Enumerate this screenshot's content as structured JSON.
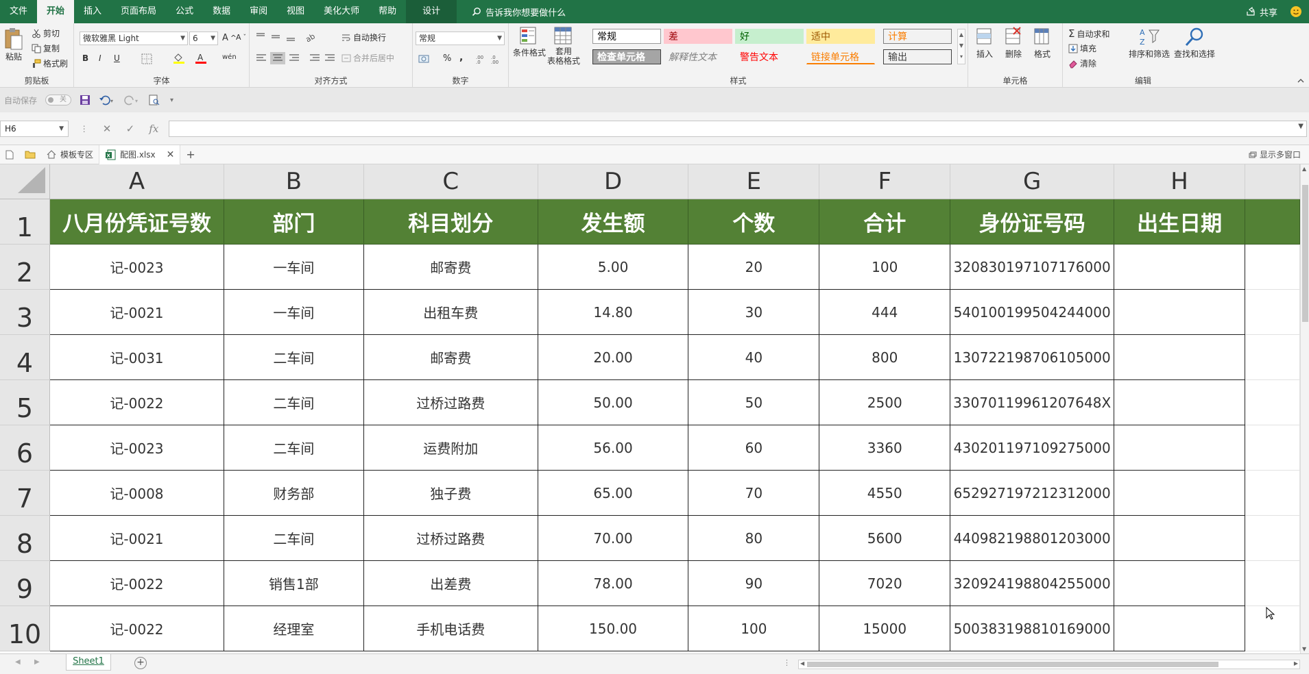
{
  "menu": {
    "items": [
      "文件",
      "开始",
      "插入",
      "页面布局",
      "公式",
      "数据",
      "审阅",
      "视图",
      "美化大师",
      "帮助"
    ],
    "active": "开始",
    "design": "设计",
    "tell_me": "告诉我你想要做什么",
    "share": "共享"
  },
  "ribbon": {
    "clipboard": {
      "label": "剪贴板",
      "paste": "粘贴",
      "cut": "剪切",
      "copy": "复制",
      "format_painter": "格式刷"
    },
    "font": {
      "label": "字体",
      "name": "微软雅黑 Light",
      "size": "6",
      "bold": "B",
      "italic": "I",
      "underline": "U",
      "wen": "wén"
    },
    "align": {
      "label": "对齐方式",
      "wrap": "自动换行",
      "merge": "合并后居中"
    },
    "number": {
      "label": "数字",
      "format": "常规",
      "percent": "%",
      "comma": ","
    },
    "styles": {
      "label": "样式",
      "conditional": "条件格式",
      "table_1": "套用",
      "table_2": "表格格式",
      "cells": [
        {
          "text": "常规",
          "bg": "#ffffff",
          "fg": "#000000",
          "border": "#999999"
        },
        {
          "text": "差",
          "bg": "#ffc7ce",
          "fg": "#9c0006",
          "border": "#ffc7ce"
        },
        {
          "text": "好",
          "bg": "#c6efce",
          "fg": "#006100",
          "border": "#c6efce"
        },
        {
          "text": "适中",
          "bg": "#ffeb9c",
          "fg": "#9c5700",
          "border": "#ffeb9c"
        },
        {
          "text": "计算",
          "bg": "#f2f2f2",
          "fg": "#fa7d00",
          "border": "#7f7f7f"
        },
        {
          "text": "检查单元格",
          "bg": "#a5a5a5",
          "fg": "#ffffff",
          "border": "#3f3f3f"
        },
        {
          "text": "解释性文本",
          "bg": "#f3f3f3",
          "fg": "#7f7f7f",
          "border": "#f3f3f3"
        },
        {
          "text": "警告文本",
          "bg": "#f3f3f3",
          "fg": "#ff0000",
          "border": "#f3f3f3"
        },
        {
          "text": "链接单元格",
          "bg": "#f3f3f3",
          "fg": "#fa7d00",
          "border": "#f3f3f3"
        },
        {
          "text": "输出",
          "bg": "#f2f2f2",
          "fg": "#3f3f3f",
          "border": "#3f3f3f"
        }
      ]
    },
    "cells_group": {
      "label": "单元格",
      "insert": "插入",
      "delete": "删除",
      "format": "格式"
    },
    "edit": {
      "label": "编辑",
      "autosum": "自动求和",
      "fill": "填充",
      "clear": "清除",
      "sort": "排序和筛选",
      "find": "查找和选择"
    }
  },
  "qat": {
    "autosave": "自动保存",
    "toggle": "关"
  },
  "formula": {
    "name_box": "H6",
    "value": ""
  },
  "tabs": {
    "template": "模板专区",
    "file": "配图.xlsx",
    "multi_window": "显示多窗口"
  },
  "sheet": {
    "columns": [
      "A",
      "B",
      "C",
      "D",
      "E",
      "F",
      "G",
      "H"
    ],
    "row_numbers": [
      "1",
      "2",
      "3",
      "4",
      "5",
      "6",
      "7",
      "8",
      "9",
      "10"
    ],
    "headers": [
      "八月份凭证号数",
      "部门",
      "科目划分",
      "发生额",
      "个数",
      "合计",
      "身份证号码",
      "出生日期"
    ],
    "rows": [
      [
        "记-0023",
        "一车间",
        "邮寄费",
        "5.00",
        "20",
        "100",
        "320830197107176000",
        ""
      ],
      [
        "记-0021",
        "一车间",
        "出租车费",
        "14.80",
        "30",
        "444",
        "540100199504244000",
        ""
      ],
      [
        "记-0031",
        "二车间",
        "邮寄费",
        "20.00",
        "40",
        "800",
        "130722198706105000",
        ""
      ],
      [
        "记-0022",
        "二车间",
        "过桥过路费",
        "50.00",
        "50",
        "2500",
        "33070119961207648X",
        ""
      ],
      [
        "记-0023",
        "二车间",
        "运费附加",
        "56.00",
        "60",
        "3360",
        "430201197109275000",
        ""
      ],
      [
        "记-0008",
        "财务部",
        "独子费",
        "65.00",
        "70",
        "4550",
        "652927197212312000",
        ""
      ],
      [
        "记-0021",
        "二车间",
        "过桥过路费",
        "70.00",
        "80",
        "5600",
        "440982198801203000",
        ""
      ],
      [
        "记-0022",
        "销售1部",
        "出差费",
        "78.00",
        "90",
        "7020",
        "320924198804255000",
        ""
      ],
      [
        "记-0022",
        "经理室",
        "手机电话费",
        "150.00",
        "100",
        "15000",
        "500383198810169000",
        ""
      ]
    ],
    "header_color": "#538135",
    "tab_name": "Sheet1"
  }
}
